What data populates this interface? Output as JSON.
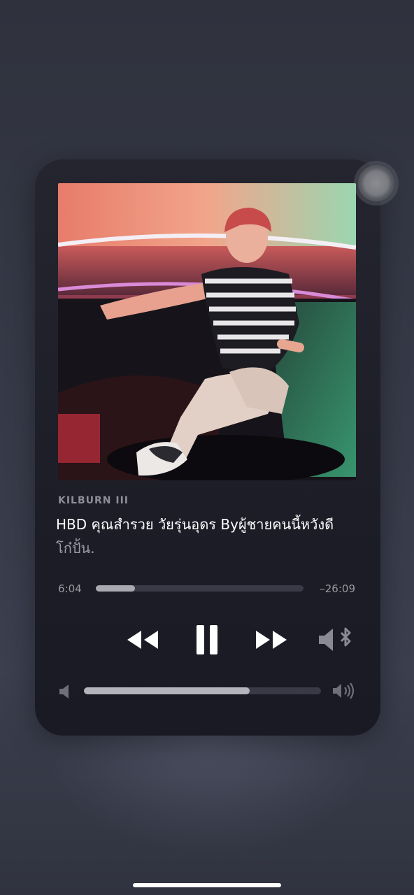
{
  "now_playing": {
    "artist": "KILBURN III",
    "title_main": "HBD คุณสำรวย วัยรุ่นอุดร  Byผู้ชายคนนี้หวังดี",
    "title_sub": "โก๋ปั้น.",
    "artwork_icon": "album-artwork-photo"
  },
  "progress": {
    "elapsed": "6:04",
    "remaining": "–26:09",
    "fraction": 0.19
  },
  "controls": {
    "rewind_icon": "rewind-icon",
    "pause_icon": "pause-icon",
    "forward_icon": "fast-forward-icon",
    "output_icon": "speaker-bluetooth-icon"
  },
  "volume": {
    "low_icon": "speaker-low-icon",
    "high_icon": "speaker-high-icon",
    "fraction": 0.7
  },
  "colors": {
    "card_bg": "#1d1d27",
    "accent_fill": "#a9a9b2",
    "text_primary": "#ffffff",
    "text_secondary": "#9a9aa3"
  }
}
